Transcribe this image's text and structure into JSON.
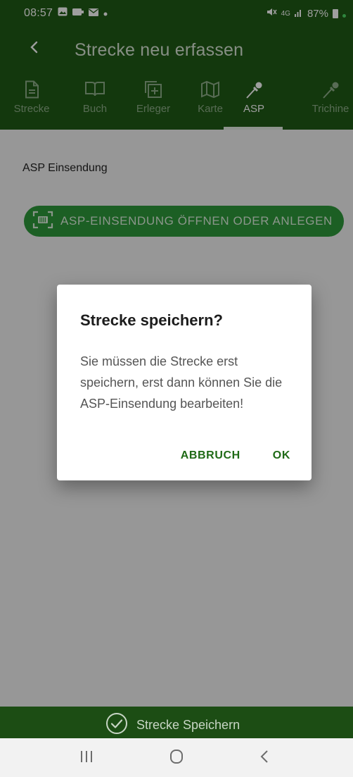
{
  "status": {
    "time": "08:57",
    "network": "4G",
    "battery": "87%"
  },
  "toolbar": {
    "back_icon": "chevron-left-icon",
    "title": "Strecke neu erfassen"
  },
  "tabs": [
    {
      "label": "Strecke",
      "icon": "document-icon"
    },
    {
      "label": "Buch",
      "icon": "book-icon"
    },
    {
      "label": "Erleger",
      "icon": "add-box-icon"
    },
    {
      "label": "Karte",
      "icon": "map-icon"
    },
    {
      "label": "ASP",
      "icon": "pipette-icon",
      "active": true
    },
    {
      "label": "Trichine",
      "icon": "pipette-icon"
    }
  ],
  "content": {
    "asp_label": "ASP Einsendung",
    "asp_button": "ASP-EINSENDUNG ÖFFNEN ODER ANLEGEN"
  },
  "dialog": {
    "title": "Strecke speichern?",
    "message": "Sie müssen die Strecke erst speichern, erst dann können Sie die ASP-Einsendung bearbeiten!",
    "cancel": "ABBRUCH",
    "ok": "OK"
  },
  "savebar": {
    "label": "Strecke Speichern"
  },
  "colors": {
    "primary": "#1f5b15",
    "accent_button": "#2e9a3b",
    "dialog_action": "#1f6a16"
  }
}
